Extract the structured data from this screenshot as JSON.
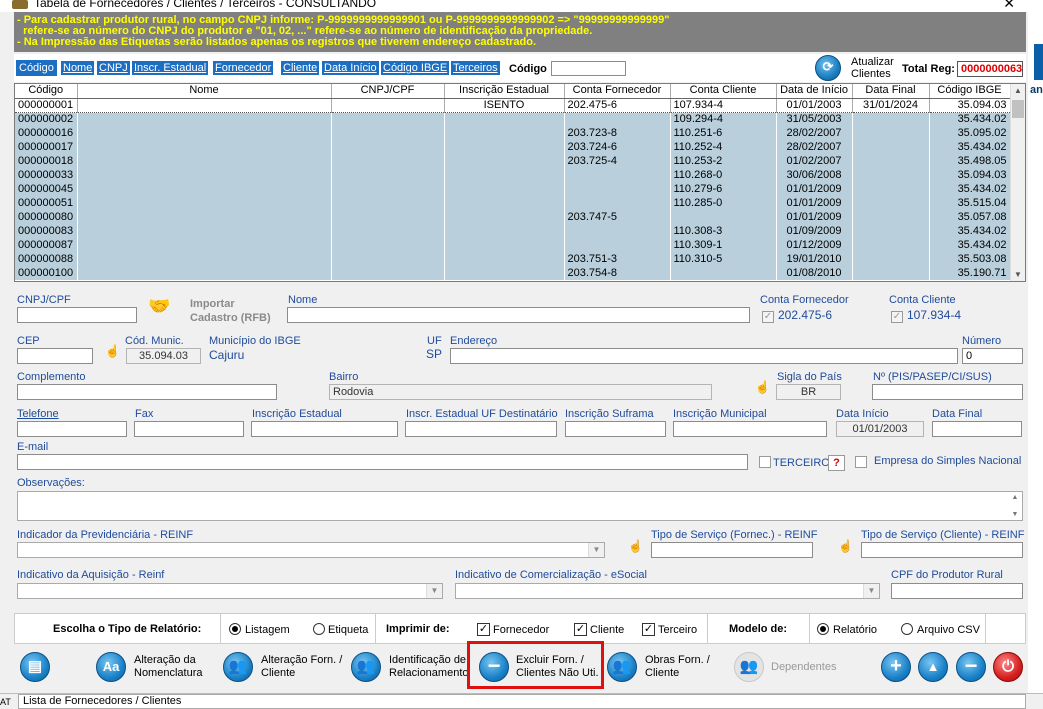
{
  "window": {
    "title": "Tabela de Fornecedores / Clientes / Terceiros - CONSULTANDO",
    "right_fragment": "an"
  },
  "banner": {
    "line1": "- Para cadastrar produtor rural, no campo CNPJ informe: P-9999999999999901 ou P-9999999999999902 => \"99999999999999\"",
    "line2": "  refere-se ao número do CNPJ do produtor e \"01, 02, ...\" refere-se ao número de identificação da propriedade.",
    "line3": "- Na Impressão das Etiquetas serão listados apenas os registros que tiverem endereço cadastrado."
  },
  "search_tabs": [
    "Código",
    "Nome",
    "CNPJ",
    "Inscr. Estadual",
    "Fornecedor",
    "Cliente",
    "Data Início",
    "Código IBGE",
    "Terceiros"
  ],
  "search": {
    "label": "Código",
    "value": ""
  },
  "update_button": {
    "label": "Atualizar Clientes"
  },
  "total_reg": {
    "label": "Total Reg:",
    "value": "0000000063"
  },
  "grid": {
    "columns": [
      "Código",
      "Nome",
      "CNPJ/CPF",
      "Inscrição Estadual",
      "Conta Fornecedor",
      "Conta Cliente",
      "Data de Início",
      "Data Final",
      "Código IBGE"
    ],
    "rows": [
      [
        "000000001",
        "",
        "",
        "ISENTO",
        "202.475-6",
        "107.934-4",
        "01/01/2003",
        "31/01/2024",
        "35.094.03"
      ],
      [
        "000000002",
        "",
        "",
        "",
        "",
        "109.294-4",
        "31/05/2003",
        "",
        "35.434.02"
      ],
      [
        "000000016",
        "",
        "",
        "",
        "203.723-8",
        "110.251-6",
        "28/02/2007",
        "",
        "35.095.02"
      ],
      [
        "000000017",
        "",
        "",
        "",
        "203.724-6",
        "110.252-4",
        "28/02/2007",
        "",
        "35.434.02"
      ],
      [
        "000000018",
        "",
        "",
        "",
        "203.725-4",
        "110.253-2",
        "01/02/2007",
        "",
        "35.498.05"
      ],
      [
        "000000033",
        "",
        "",
        "",
        "",
        "110.268-0",
        "30/06/2008",
        "",
        "35.094.03"
      ],
      [
        "000000045",
        "",
        "",
        "",
        "",
        "110.279-6",
        "01/01/2009",
        "",
        "35.434.02"
      ],
      [
        "000000051",
        "",
        "",
        "",
        "",
        "110.285-0",
        "01/01/2009",
        "",
        "35.515.04"
      ],
      [
        "000000080",
        "",
        "",
        "",
        "203.747-5",
        "",
        "01/01/2009",
        "",
        "35.057.08"
      ],
      [
        "000000083",
        "",
        "",
        "",
        "",
        "110.308-3",
        "01/09/2009",
        "",
        "35.434.02"
      ],
      [
        "000000087",
        "",
        "",
        "",
        "",
        "110.309-1",
        "01/12/2009",
        "",
        "35.434.02"
      ],
      [
        "000000088",
        "",
        "",
        "",
        "203.751-3",
        "110.310-5",
        "19/01/2010",
        "",
        "35.503.08"
      ],
      [
        "000000100",
        "",
        "",
        "",
        "203.754-8",
        "",
        "01/08/2010",
        "",
        "35.190.71"
      ]
    ]
  },
  "form": {
    "cnpj_label": "CNPJ/CPF",
    "cnpj_value": "",
    "import_label1": "Importar",
    "import_label2": "Cadastro (RFB)",
    "nome_label": "Nome",
    "nome_value": "",
    "conta_fornecedor_label": "Conta Fornecedor",
    "conta_fornecedor_value": "202.475-6",
    "conta_cliente_label": "Conta Cliente",
    "conta_cliente_value": "107.934-4",
    "cep_label": "CEP",
    "cep_value": "",
    "cod_munic_label": "Cód. Munic.",
    "cod_munic_value": "35.094.03",
    "municipio_label": "Município do IBGE",
    "municipio_value": "Cajuru",
    "uf_label": "UF",
    "uf_value": "SP",
    "endereco_label": "Endereço",
    "endereco_value": "",
    "numero_label": "Número",
    "numero_value": "0",
    "complemento_label": "Complemento",
    "complemento_value": "",
    "bairro_label": "Bairro",
    "bairro_value": "Rodovia",
    "sigla_pais_label": "Sigla do País",
    "sigla_pais_value": "BR",
    "nis_label": "Nº (PIS/PASEP/CI/SUS)",
    "nis_value": "",
    "telefone_label": "Telefone",
    "fax_label": "Fax",
    "ie_label": "Inscrição Estadual",
    "ie_uf_label": "Inscr. Estadual UF Destinatário",
    "suframa_label": "Inscrição Suframa",
    "im_label": "Inscrição Municipal",
    "data_inicio_label": "Data Início",
    "data_inicio_value": "01/01/2003",
    "data_final_label": "Data Final",
    "data_final_value": "",
    "email_label": "E-mail",
    "email_value": "",
    "terceiro_label": "TERCEIRO",
    "help_label": "?",
    "simples_label": "Empresa do Simples Nacional",
    "obs_label": "Observações:",
    "prev_label": "Indicador da Previdenciária - REINF",
    "tipo_serv_forn_label": "Tipo de Serviço (Fornec.) - REINF",
    "tipo_serv_cli_label": "Tipo de Serviço (Cliente) - REINF",
    "aquisicao_label": "Indicativo da Aquisição - Reinf",
    "comerc_label": "Indicativo de Comercialização - eSocial",
    "cpf_produtor_label": "CPF do Produtor Rural"
  },
  "report": {
    "tipo_label": "Escolha o Tipo de Relatório:",
    "listagem": "Listagem",
    "etiqueta": "Etiqueta",
    "imprimir_label": "Imprimir de:",
    "fornecedor": "Fornecedor",
    "cliente": "Cliente",
    "terceiro": "Terceiro",
    "modelo_label": "Modelo de:",
    "relatorio": "Relatório",
    "arquivo_csv": "Arquivo CSV",
    "check_mark": "✓"
  },
  "buttons": {
    "alteracao_nomenclatura": [
      "Alteração da",
      "Nomenclatura"
    ],
    "alteracao_forn_cliente": [
      "Alteração Forn. /",
      "Cliente"
    ],
    "identificacao": [
      "Identificação de",
      "Relacionamento"
    ],
    "excluir": [
      "Excluir Forn. /",
      "Clientes Não Uti."
    ],
    "obras": [
      "Obras Forn. /",
      "Cliente"
    ],
    "dependentes": [
      "Dependentes"
    ],
    "aa_glyph": "Aa"
  },
  "status": {
    "text": "Lista de Fornecedores / Clientes",
    "left": "AT"
  }
}
